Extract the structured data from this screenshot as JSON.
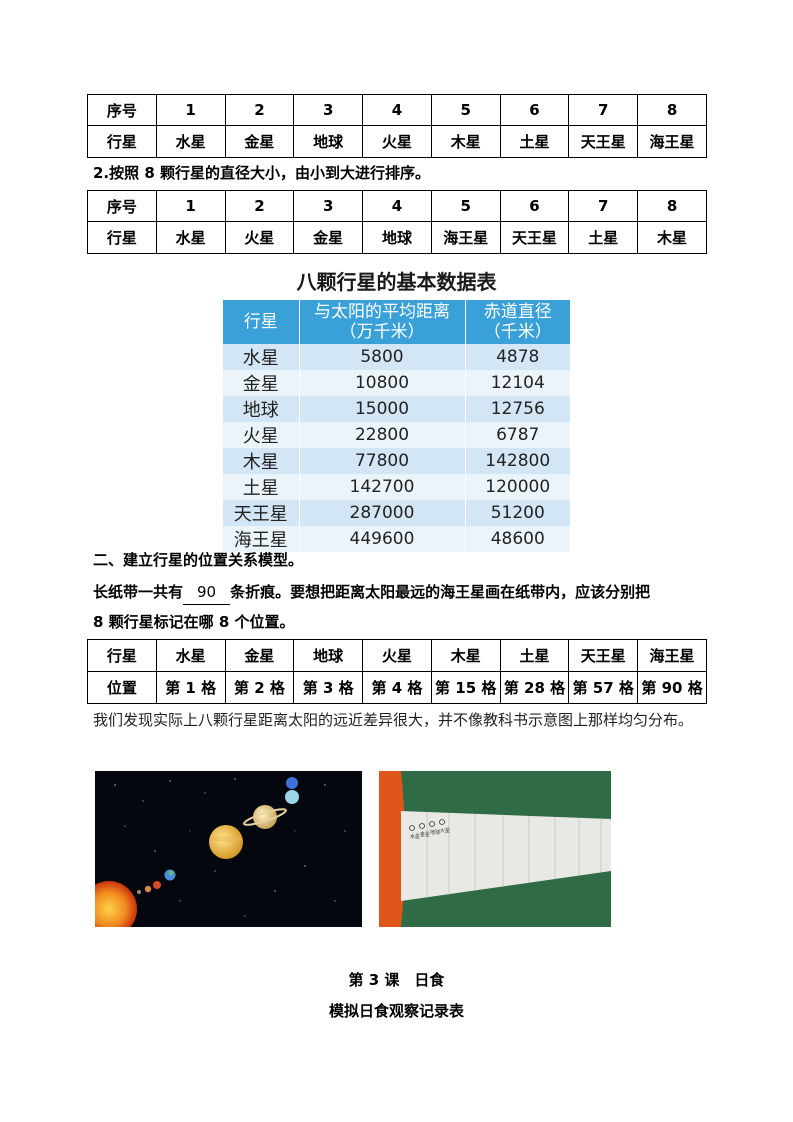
{
  "table1": {
    "row1": [
      "序号",
      "1",
      "2",
      "3",
      "4",
      "5",
      "6",
      "7",
      "8"
    ],
    "row2": [
      "行星",
      "水星",
      "金星",
      "地球",
      "火星",
      "木星",
      "土星",
      "天王星",
      "海王星"
    ]
  },
  "q2": {
    "text": "2.按照 8 颗行星的直径大小，由小到大进行排序。"
  },
  "table2": {
    "row1": [
      "序号",
      "1",
      "2",
      "3",
      "4",
      "5",
      "6",
      "7",
      "8"
    ],
    "row2": [
      "行星",
      "水星",
      "火星",
      "金星",
      "地球",
      "海王星",
      "天王星",
      "土星",
      "木星"
    ]
  },
  "data_table": {
    "title": "八颗行星的基本数据表",
    "headers": {
      "planet": "行星",
      "distance_l1": "与太阳的平均距离",
      "distance_l2": "（万千米）",
      "diameter_l1": "赤道直径",
      "diameter_l2": "（千米）"
    },
    "rows": [
      {
        "planet": "水星",
        "distance": "5800",
        "diameter": "4878"
      },
      {
        "planet": "金星",
        "distance": "10800",
        "diameter": "12104"
      },
      {
        "planet": "地球",
        "distance": "15000",
        "diameter": "12756"
      },
      {
        "planet": "火星",
        "distance": "22800",
        "diameter": "6787"
      },
      {
        "planet": "木星",
        "distance": "77800",
        "diameter": "142800"
      },
      {
        "planet": "土星",
        "distance": "142700",
        "diameter": "120000"
      },
      {
        "planet": "天王星",
        "distance": "287000",
        "diameter": "51200"
      },
      {
        "planet": "海王星",
        "distance": "449600",
        "diameter": "48600"
      }
    ]
  },
  "section2": {
    "heading": "二、建立行星的位置关系模型。",
    "line1_prefix": "长纸带一共有",
    "line1_blank": "90",
    "line1_suffix": "条折痕。要想把距离太阳最远的海王星画在纸带内，应该分别把",
    "line2": "8 颗行星标记在哪 8 个位置。"
  },
  "table3": {
    "row1": [
      "行星",
      "水星",
      "金星",
      "地球",
      "火星",
      "木星",
      "土星",
      "天王星",
      "海王星"
    ],
    "row2": [
      "位置",
      "第 1 格",
      "第 2 格",
      "第 3 格",
      "第 4 格",
      "第 15 格",
      "第 28 格",
      "第 57 格",
      "第 90 格"
    ]
  },
  "finding": {
    "text": "我们发现实际上八颗行星距离太阳的远近差异很大，并不像教科书示意图上那样均匀分布。"
  },
  "strip_marks": [
    "水星",
    "金星",
    "地球",
    "火星"
  ],
  "lesson": {
    "title": "第 3 课　日食",
    "subtitle": "模拟日食观察记录表"
  },
  "colors": {
    "table_header_blue": "#3aa0d8",
    "row_blue": "#d3e6f6",
    "row_light": "#ecf4fb",
    "board_green": "#2f6b45",
    "sun_orange": "#e0561a"
  }
}
